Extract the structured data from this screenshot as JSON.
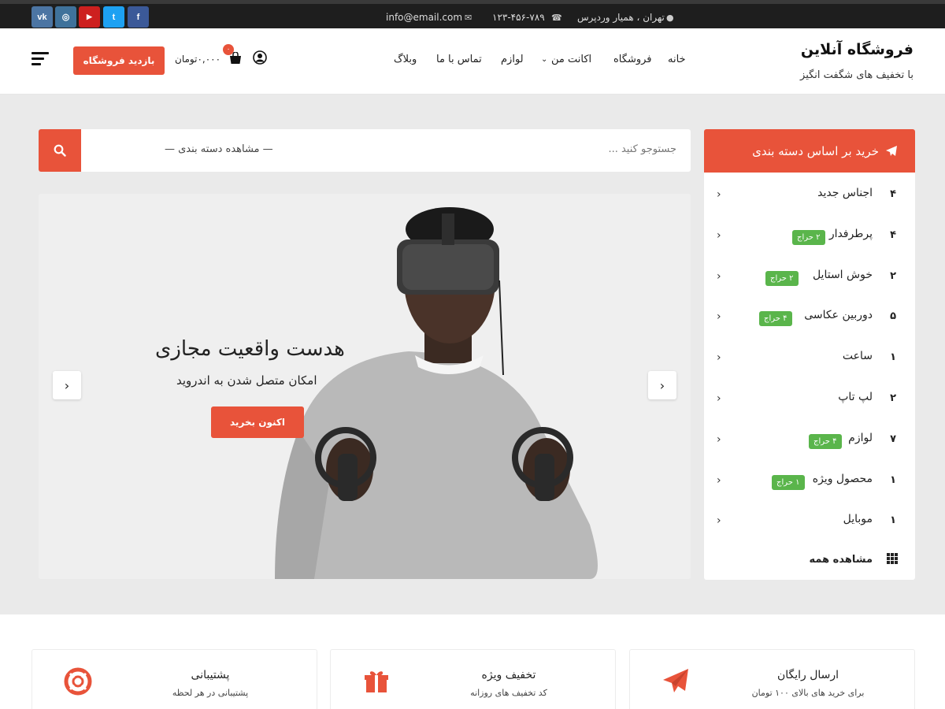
{
  "topbar": {
    "social": [
      {
        "name": "vk",
        "label": "vk",
        "color": "#4c75a3"
      },
      {
        "name": "instagram",
        "label": "◎",
        "color": "#3f729b"
      },
      {
        "name": "youtube",
        "label": "▶",
        "color": "#cd201f"
      },
      {
        "name": "twitter",
        "label": "t",
        "color": "#1da1f2"
      },
      {
        "name": "facebook",
        "label": "f",
        "color": "#3b5998"
      }
    ],
    "email": "info@email.com",
    "phone": "۱۲۳-۴۵۶-۷۸۹",
    "address": "تهران ، همیار وردپرس"
  },
  "header": {
    "site_title": "فروشگاه آنلاین",
    "tagline": "با تخفیف های شگفت انگیز",
    "nav": {
      "home": "خانه",
      "shop": "فروشگاه",
      "account": "اکانت من",
      "accessories": "لوازم",
      "contact": "تماس با ما",
      "blog": "وبلاگ"
    },
    "visit_shop": "بازدید فروشگاه",
    "cart_price": "۰,۰۰۰تومان",
    "cart_count": "۰"
  },
  "categories": {
    "heading": "خرید بر اساس دسته بندی",
    "items": [
      {
        "name": "اجناس جدید",
        "count": "۴",
        "badge": ""
      },
      {
        "name": "پرطرفدار",
        "count": "۴",
        "badge": "۲ حراج"
      },
      {
        "name": "خوش استایل",
        "count": "۲",
        "badge": "۲ حراج"
      },
      {
        "name": "دوربین عکاسی",
        "count": "۵",
        "badge": "۴ حراج"
      },
      {
        "name": "ساعت",
        "count": "۱",
        "badge": ""
      },
      {
        "name": "لپ تاپ",
        "count": "۲",
        "badge": ""
      },
      {
        "name": "لوازم",
        "count": "۷",
        "badge": "۴ حراج"
      },
      {
        "name": "محصول ویژه",
        "count": "۱",
        "badge": "۱ حراج"
      },
      {
        "name": "موبایل",
        "count": "۱",
        "badge": ""
      }
    ],
    "view_all": "مشاهده همه"
  },
  "search": {
    "placeholder": "جستوجو کنید ...",
    "category_select": "— مشاهده دسته بندی —"
  },
  "slider": {
    "title": "هدست واقعیت مجازی",
    "subtitle": "امکان متصل شدن به اندروید",
    "button": "اکنون بخرید"
  },
  "features": [
    {
      "title": "ارسال رایگان",
      "subtitle": "برای خرید های بالای ۱۰۰ تومان",
      "icon": "paper-plane-icon"
    },
    {
      "title": "تخفیف ویژه",
      "subtitle": "کد تخفیف های روزانه",
      "icon": "gift-icon"
    },
    {
      "title": "پشتیبانی",
      "subtitle": "پشتیبانی در هر لحظه",
      "icon": "lifebuoy-icon"
    }
  ],
  "colors": {
    "accent": "#e8533a",
    "badge": "#5ab54b",
    "topbar": "#1e1e1e"
  }
}
